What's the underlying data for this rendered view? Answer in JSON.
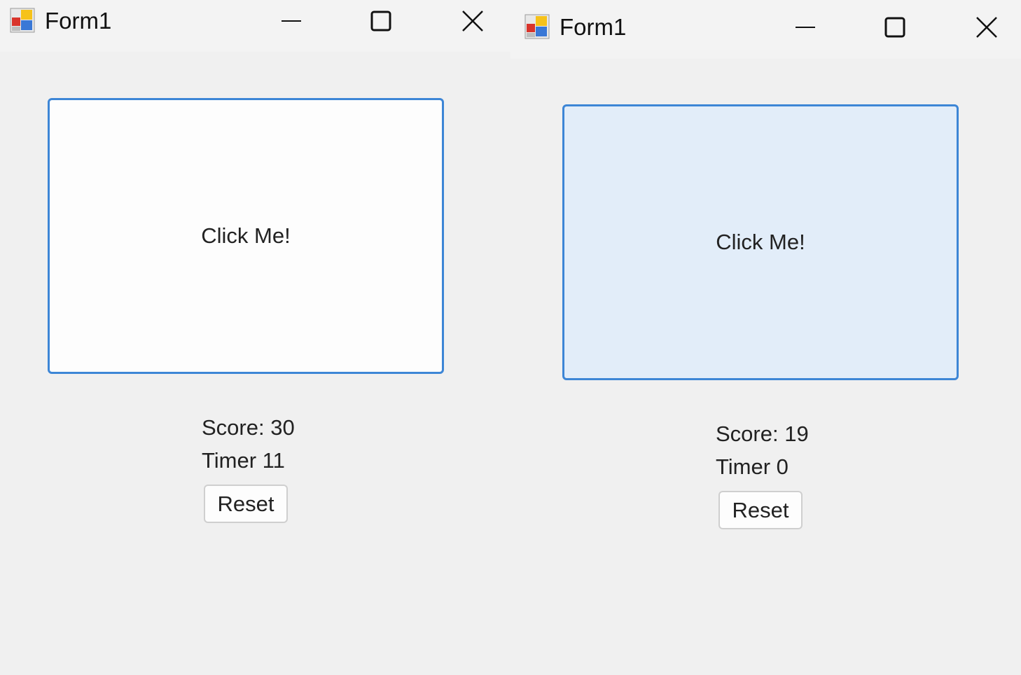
{
  "windows": [
    {
      "title": "Form1",
      "click_button_label": "Click Me!",
      "score_label": "Score:  30",
      "timer_label": "Timer 11",
      "reset_label": "Reset",
      "click_button_state": "normal"
    },
    {
      "title": "Form1",
      "click_button_label": "Click Me!",
      "score_label": "Score:  19",
      "timer_label": "Timer 0",
      "reset_label": "Reset",
      "click_button_state": "hover"
    }
  ],
  "icons": {
    "app": "winforms-app-icon",
    "minimize": "minimize-icon",
    "maximize": "maximize-icon",
    "close": "close-icon"
  },
  "colors": {
    "window_background": "#f0f0f0",
    "titlebar_background": "#f3f3f3",
    "button_border_focus": "#3d86d6",
    "button_hover_fill": "#e2edf9"
  }
}
